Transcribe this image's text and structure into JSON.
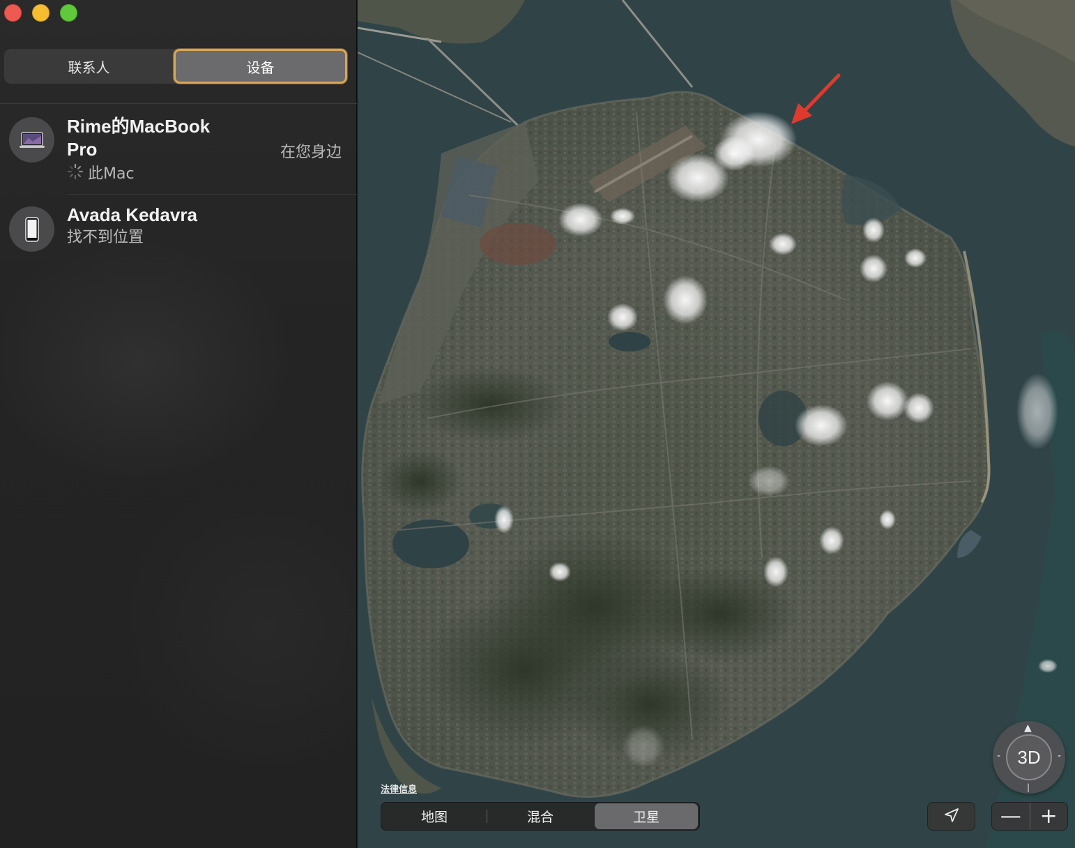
{
  "window": {
    "controls": [
      "close",
      "minimize",
      "zoom"
    ]
  },
  "sidebar": {
    "tabs": [
      {
        "label": "联系人",
        "selected": false
      },
      {
        "label": "设备",
        "selected": true
      }
    ],
    "devices": [
      {
        "name_line1": "Rime的MacBook",
        "name_line2": "Pro",
        "subtitle": "此Mac",
        "status_icon": "spinner-icon",
        "distance": "在您身边",
        "icon": "macbook-icon"
      },
      {
        "name_line1": "Avada Kedavra",
        "subtitle": "找不到位置",
        "icon": "iphone-icon"
      }
    ]
  },
  "map": {
    "legal_label": "法律信息",
    "map_types": [
      {
        "label": "地图",
        "selected": false
      },
      {
        "label": "混合",
        "selected": false
      },
      {
        "label": "卫星",
        "selected": true
      }
    ],
    "compass_label": "3D",
    "zoom_out_label": "—",
    "zoom_in_label": "+",
    "annotation_color": "#e03a2e"
  }
}
